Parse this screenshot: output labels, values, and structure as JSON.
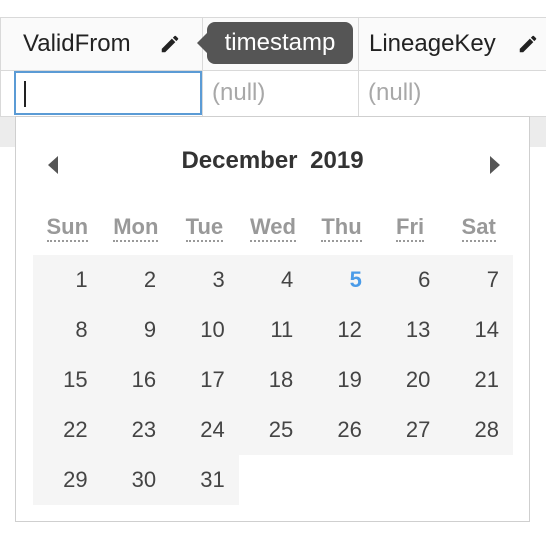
{
  "grid": {
    "columns": [
      {
        "name": "ValidFrom"
      },
      {
        "name": ""
      },
      {
        "name": "LineageKey"
      }
    ],
    "tooltip": "timestamp",
    "row_values": [
      "",
      "(null)",
      "(null)"
    ]
  },
  "icons": {
    "edit": "pencil-icon",
    "prev": "triangle-left-icon",
    "next": "triangle-right-icon"
  },
  "datepicker": {
    "month": "December",
    "year": "2019",
    "weekdays": [
      "Sun",
      "Mon",
      "Tue",
      "Wed",
      "Thu",
      "Fri",
      "Sat"
    ],
    "weeks": [
      [
        "1",
        "2",
        "3",
        "4",
        "5",
        "6",
        "7"
      ],
      [
        "8",
        "9",
        "10",
        "11",
        "12",
        "13",
        "14"
      ],
      [
        "15",
        "16",
        "17",
        "18",
        "19",
        "20",
        "21"
      ],
      [
        "22",
        "23",
        "24",
        "25",
        "26",
        "27",
        "28"
      ],
      [
        "29",
        "30",
        "31",
        "",
        "",
        "",
        ""
      ]
    ],
    "today": "5",
    "today_color": "#4a9be8"
  }
}
